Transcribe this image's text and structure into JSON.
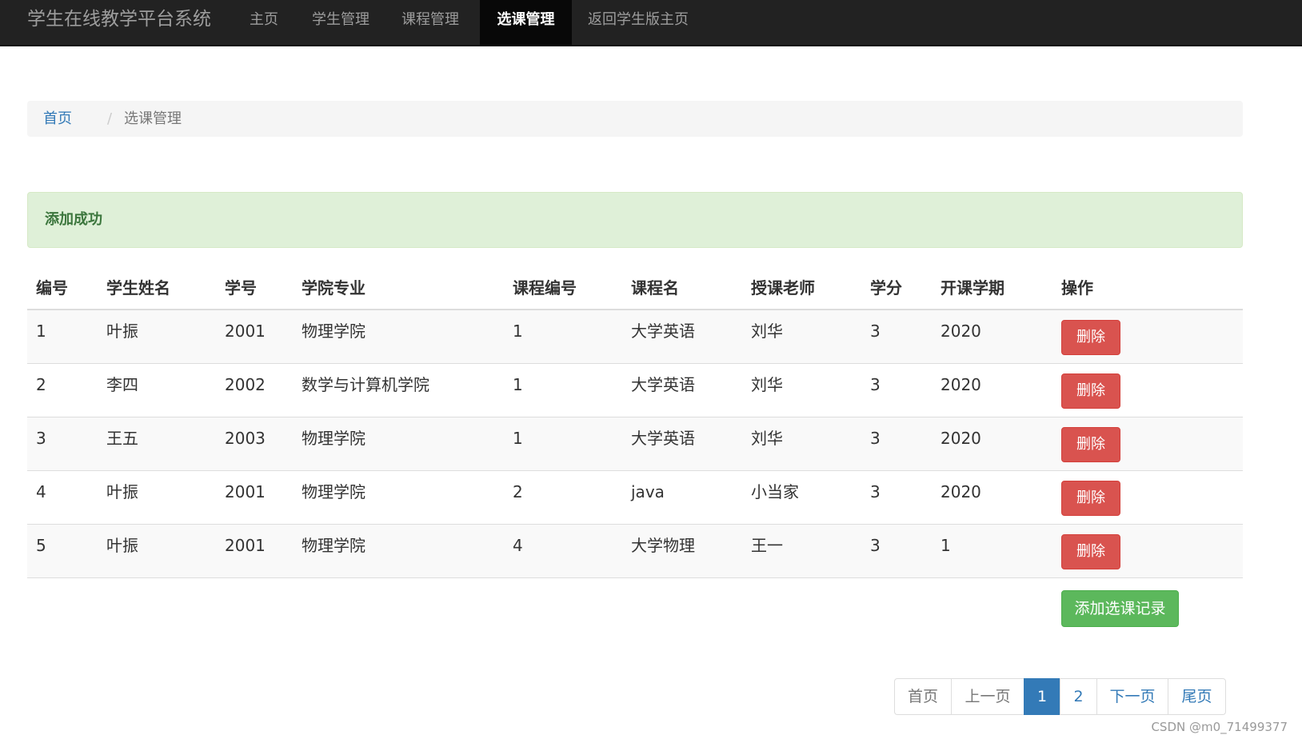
{
  "navbar": {
    "brand": "学生在线教学平台系统",
    "items": [
      {
        "label": "主页"
      },
      {
        "label": "学生管理"
      },
      {
        "label": "课程管理"
      },
      {
        "label": "选课管理"
      },
      {
        "label": "返回学生版主页"
      }
    ]
  },
  "breadcrumb": {
    "home": "首页",
    "separator": "/",
    "current": "选课管理"
  },
  "alert": {
    "message": "添加成功"
  },
  "table": {
    "headers": [
      "编号",
      "学生姓名",
      "学号",
      "学院专业",
      "课程编号",
      "课程名",
      "授课老师",
      "学分",
      "开课学期",
      "操作"
    ],
    "delete_label": "删除",
    "rows": [
      [
        "1",
        "叶振",
        "2001",
        "物理学院",
        "1",
        "大学英语",
        "刘华",
        "3",
        "2020"
      ],
      [
        "2",
        "李四",
        "2002",
        "数学与计算机学院",
        "1",
        "大学英语",
        "刘华",
        "3",
        "2020"
      ],
      [
        "3",
        "王五",
        "2003",
        "物理学院",
        "1",
        "大学英语",
        "刘华",
        "3",
        "2020"
      ],
      [
        "4",
        "叶振",
        "2001",
        "物理学院",
        "2",
        "java",
        "小当家",
        "3",
        "2020"
      ],
      [
        "5",
        "叶振",
        "2001",
        "物理学院",
        "4",
        "大学物理",
        "王一",
        "3",
        "1"
      ]
    ]
  },
  "add_button": "添加选课记录",
  "pagination": {
    "first": "首页",
    "prev": "上一页",
    "pages": [
      "1",
      "2"
    ],
    "active_page": "1",
    "next": "下一页",
    "last": "尾页"
  },
  "watermark": "CSDN @m0_71499377",
  "colors": {
    "navbar_bg": "#222222",
    "primary": "#337ab7",
    "danger": "#d9534f",
    "success": "#5cb85c",
    "alert_bg": "#dff0d8"
  }
}
